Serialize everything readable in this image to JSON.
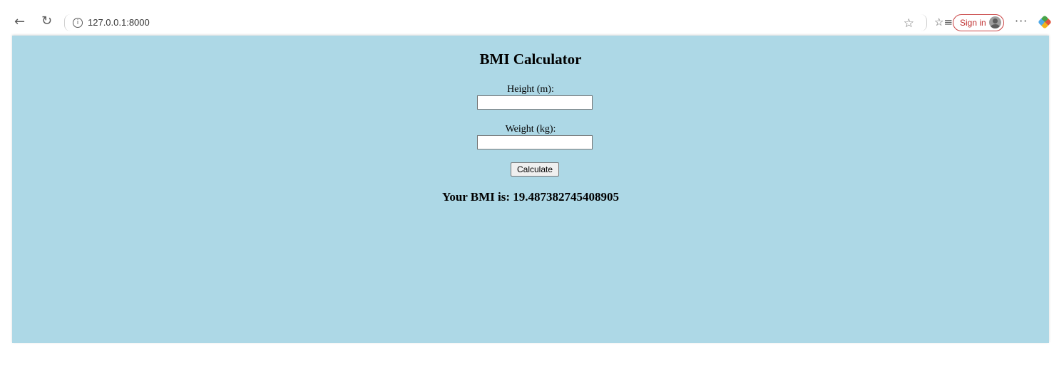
{
  "browser": {
    "url": "127.0.0.1:8000",
    "sign_in_label": "Sign in",
    "icons": {
      "back": "back-arrow-icon",
      "reload": "reload-icon",
      "info": "info-icon",
      "favorite": "star-icon",
      "favorites": "favorites-icon",
      "more": "more-icon",
      "copilot": "copilot-icon"
    },
    "colors": {
      "sign_in_accent": "#c94545"
    }
  },
  "page": {
    "background_color": "#add8e6",
    "title": "BMI Calculator",
    "height_label": "Height (m):",
    "height_value": "",
    "weight_label": "Weight (kg):",
    "weight_value": "",
    "calculate_label": "Calculate",
    "result_text": "Your BMI is: 19.487382745408905"
  }
}
